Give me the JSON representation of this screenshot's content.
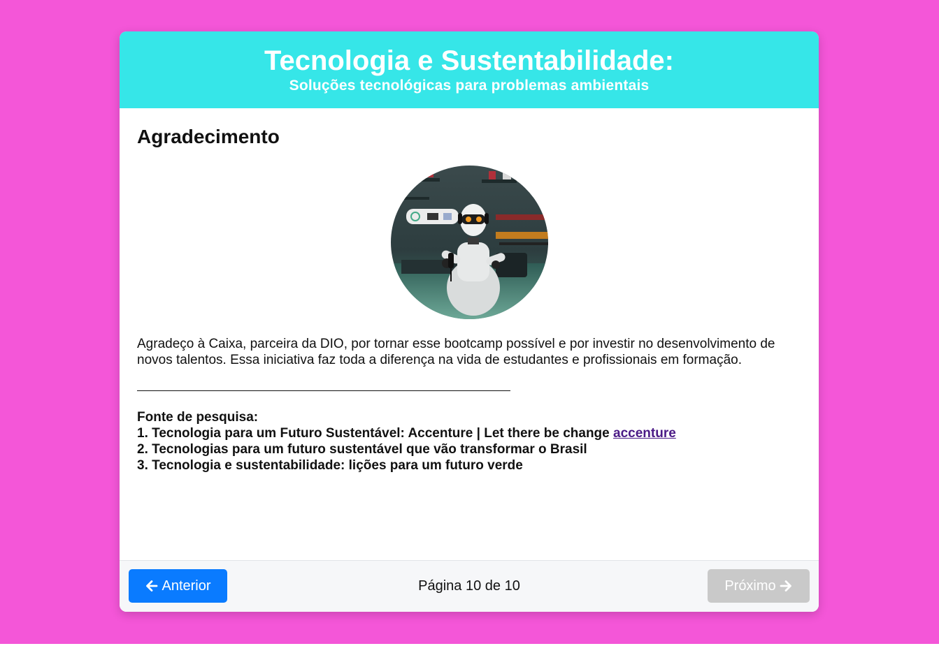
{
  "header": {
    "title": "Tecnologia e Sustentabilidade:",
    "subtitle": "Soluções tecnológicas para problemas ambientais"
  },
  "section": {
    "heading": "Agradecimento",
    "image_alt": "robot-podcast-image",
    "paragraph": "Agradeço à Caixa, parceira da DIO, por tornar esse bootcamp possível e por investir no desenvolvimento de novos talentos. Essa iniciativa faz toda a diferença na vida de estudantes e profissionais em formação."
  },
  "sources": {
    "label": "Fonte de pesquisa:",
    "items": [
      {
        "text": "1. Tecnologia para um Futuro Sustentável: Accenture | Let there be change ",
        "link": "accenture"
      },
      {
        "text": "2. Tecnologias para um futuro sustentável que vão transformar o Brasil"
      },
      {
        "text": "3. Tecnologia e sustentabilidade: lições para um futuro verde"
      }
    ]
  },
  "footer": {
    "prev_label": "Anterior",
    "next_label": "Próximo",
    "page_info": "Página 10 de 10"
  },
  "colors": {
    "background": "#f456d8",
    "header": "#36e6e8",
    "prev_button": "#0a7bff",
    "next_button_disabled": "#c9c9c9",
    "link": "#4b1a86"
  },
  "icons": {
    "prev": "arrow-left-icon",
    "next": "arrow-right-icon"
  }
}
